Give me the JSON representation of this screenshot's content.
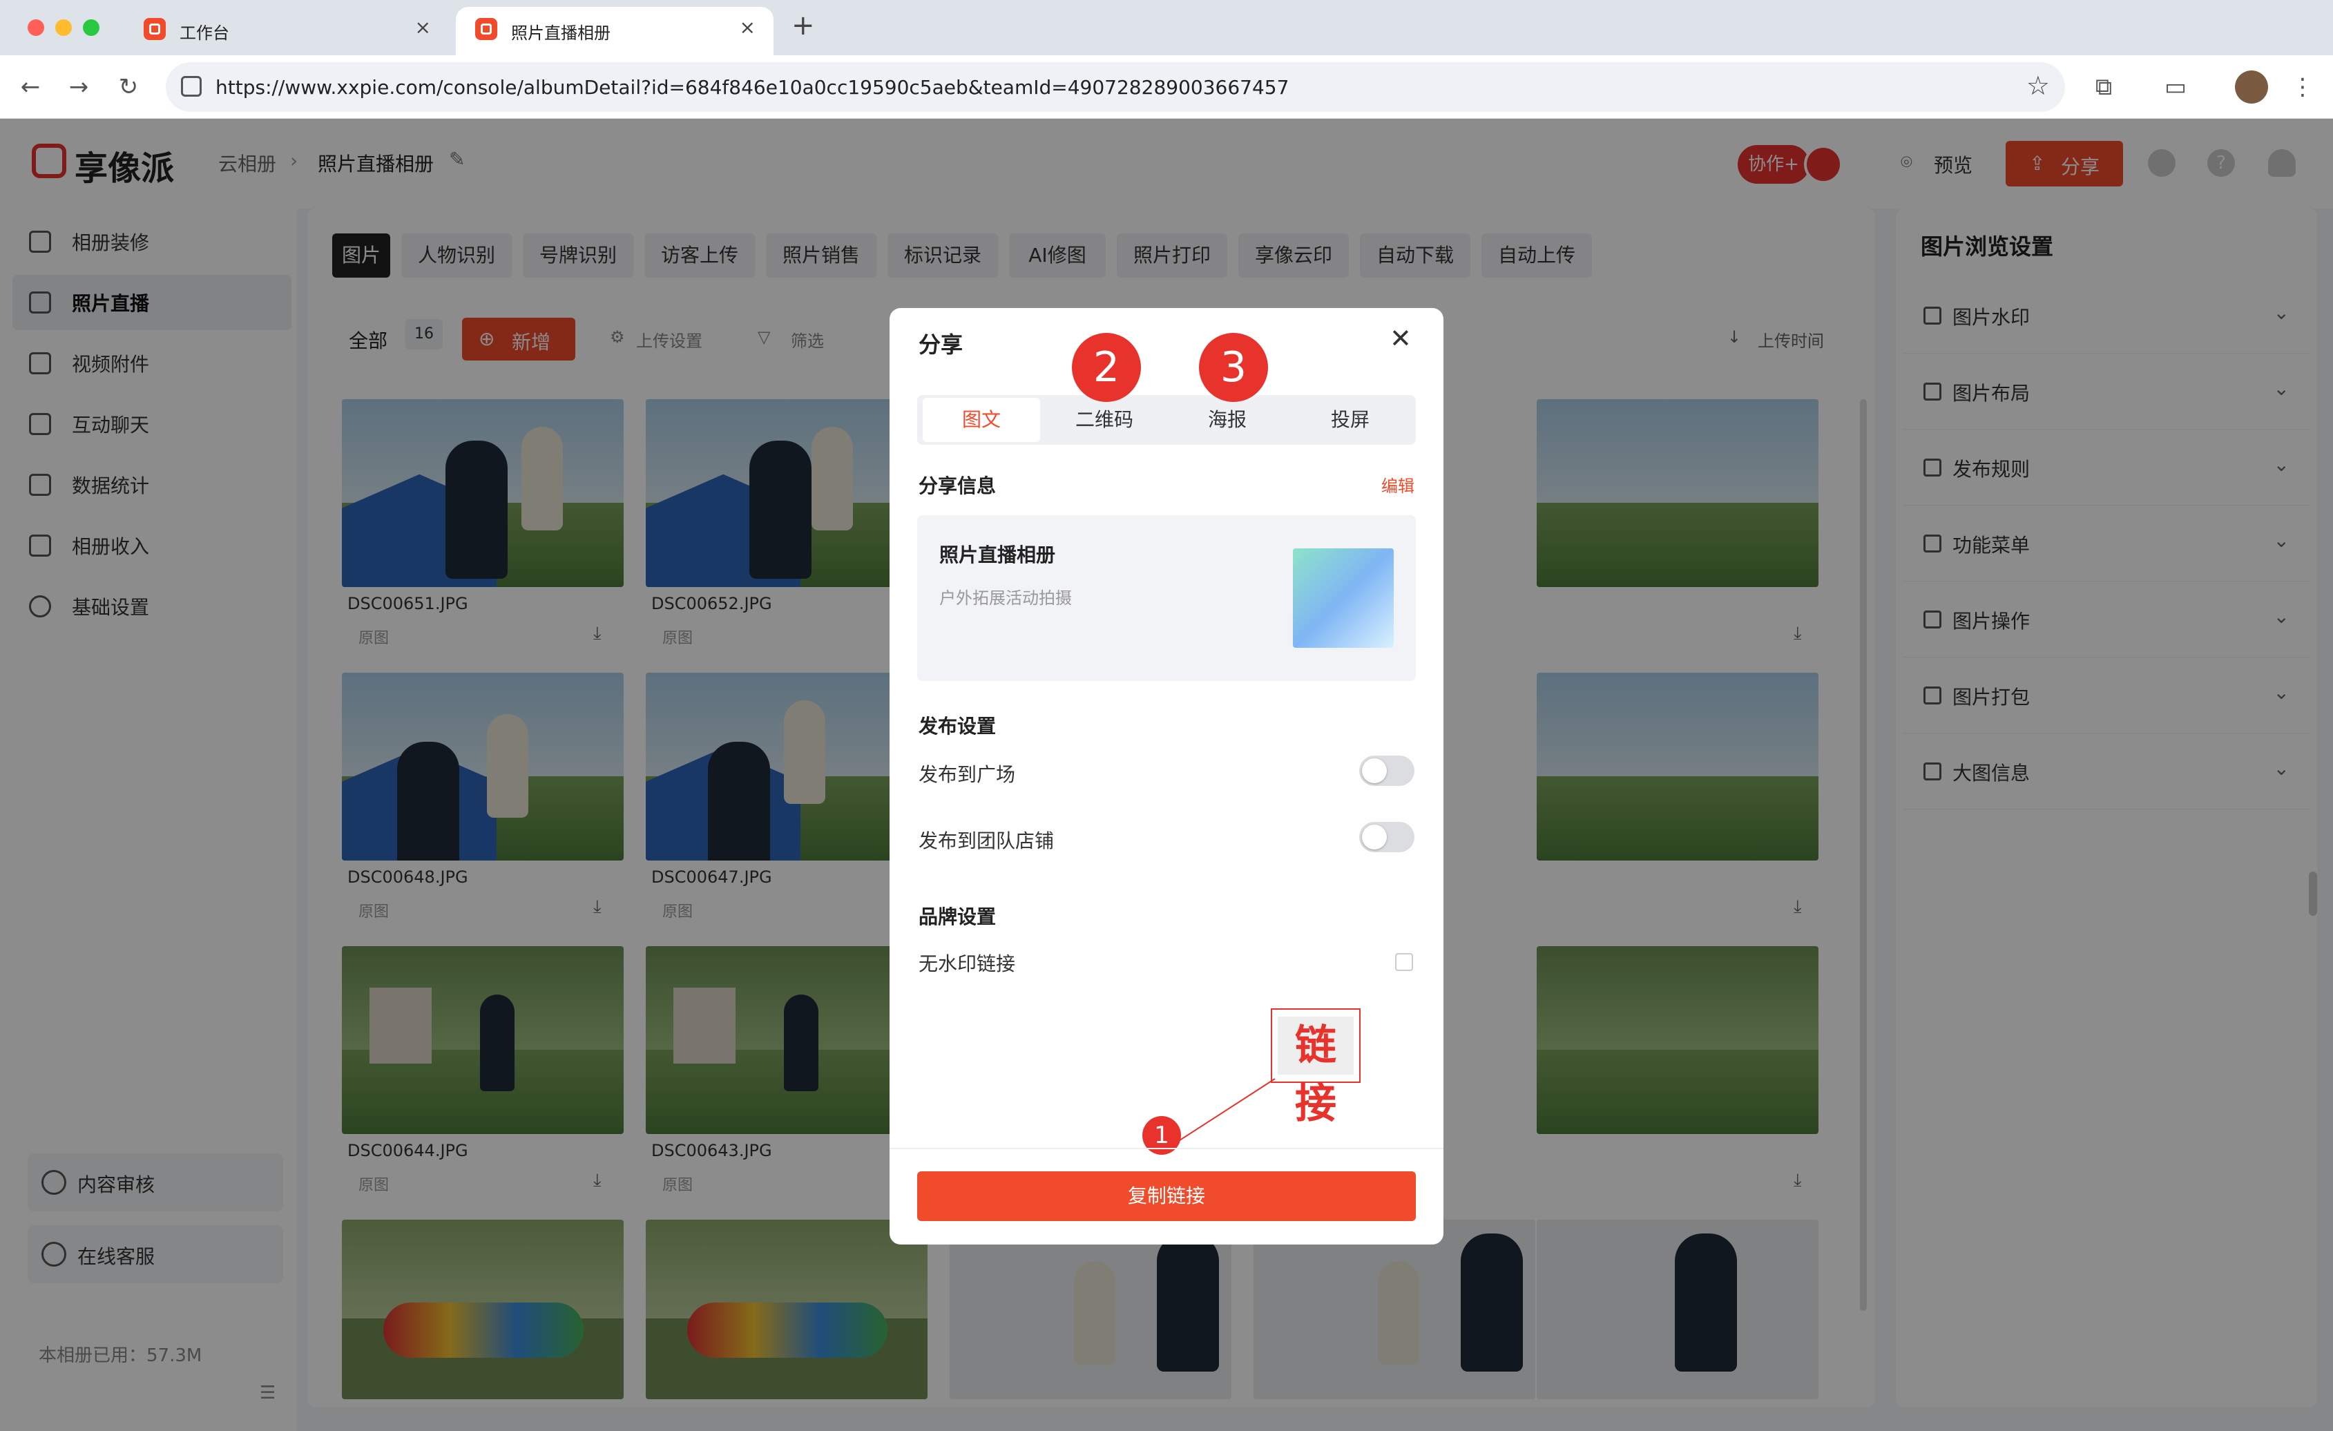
{
  "browser": {
    "tabs": [
      {
        "label": "工作台"
      },
      {
        "label": "照片直播相册"
      }
    ],
    "url": "https://www.xxpie.com/console/albumDetail?id=684f846e10a0cc19590c5aeb&teamId=490728289003667457"
  },
  "header": {
    "logo": "享像派",
    "breadcrumb_root": "云相册",
    "breadcrumb_current": "照片直播相册",
    "collab": "协作+",
    "preview": "预览",
    "share": "分享"
  },
  "sidebar": {
    "items": [
      {
        "label": "相册装修"
      },
      {
        "label": "照片直播"
      },
      {
        "label": "视频附件"
      },
      {
        "label": "互动聊天"
      },
      {
        "label": "数据统计"
      },
      {
        "label": "相册收入"
      },
      {
        "label": "基础设置"
      }
    ],
    "review": "内容审核",
    "support": "在线客服",
    "storage": "本相册已用：57.3M"
  },
  "main": {
    "tabs": [
      "图片",
      "人物识别",
      "号牌识别",
      "访客上传",
      "照片销售",
      "标识记录",
      "AI修图",
      "照片打印",
      "享像云印",
      "自动下载",
      "自动上传"
    ],
    "all_label": "全部",
    "count": "16",
    "add": "新增",
    "upload_settings": "上传设置",
    "filter": "筛选",
    "sort": "上传时间",
    "photos": [
      {
        "name": "DSC00651.JPG",
        "tag": "原图"
      },
      {
        "name": "DSC00652.JPG",
        "tag": "原图"
      },
      {
        "name": "DSC00648.JPG",
        "tag": "原图"
      },
      {
        "name": "DSC00647.JPG",
        "tag": "原图"
      },
      {
        "name": "DSC00644.JPG",
        "tag": "原图"
      },
      {
        "name": "DSC00643.JPG",
        "tag": "原图"
      }
    ]
  },
  "right_panel": {
    "title": "图片浏览设置",
    "items": [
      "图片水印",
      "图片布局",
      "发布规则",
      "功能菜单",
      "图片操作",
      "图片打包",
      "大图信息"
    ]
  },
  "modal": {
    "title": "分享",
    "tabs": [
      "图文",
      "二维码",
      "海报",
      "投屏"
    ],
    "share_info": "分享信息",
    "edit": "编辑",
    "card_title": "照片直播相册",
    "card_subtitle": "户外拓展活动拍摄",
    "publish_settings": "发布设置",
    "publish_square": "发布到广场",
    "publish_shop": "发布到团队店铺",
    "brand_settings": "品牌设置",
    "no_watermark": "无水印链接",
    "annotation_text": "链接",
    "copy_link": "复制链接",
    "badges": [
      "1",
      "2",
      "3"
    ]
  },
  "colors": {
    "accent": "#f04b2a",
    "badge": "#e8322c"
  }
}
